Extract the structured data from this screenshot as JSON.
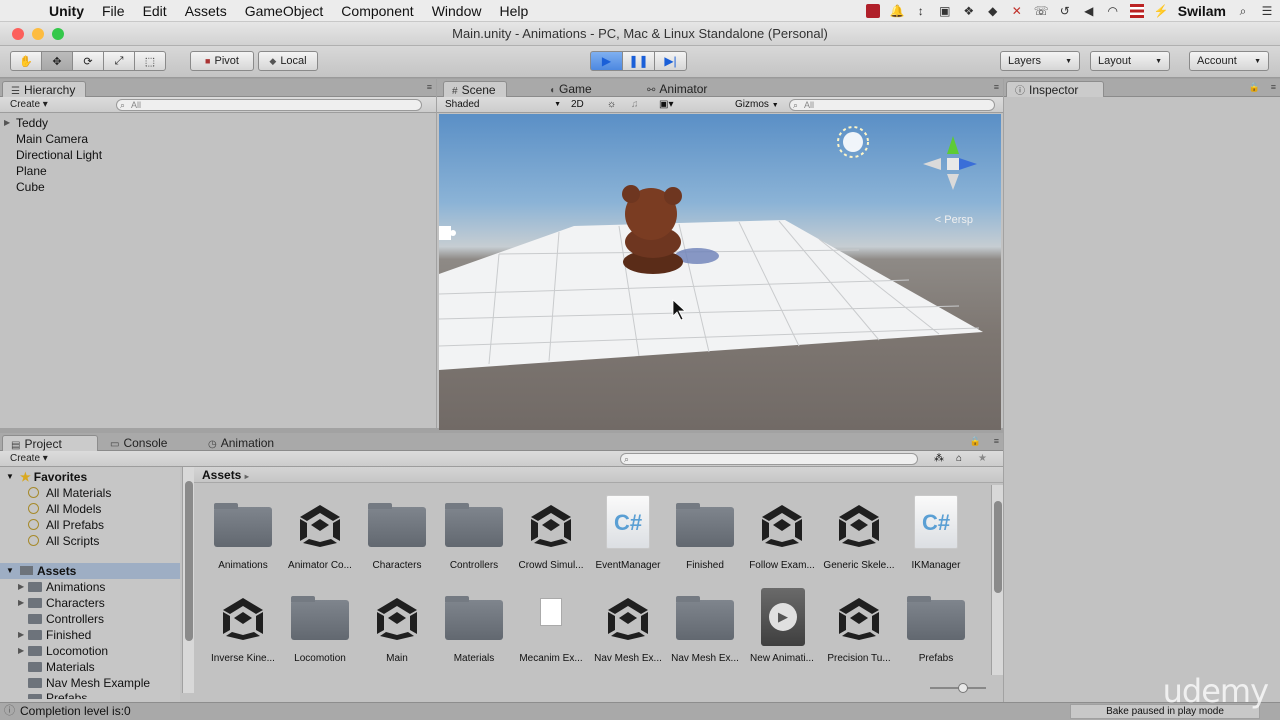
{
  "menubar": {
    "app": "Unity",
    "items": [
      "File",
      "Edit",
      "Assets",
      "GameObject",
      "Component",
      "Window",
      "Help"
    ],
    "user": "Swilam"
  },
  "window": {
    "title": "Main.unity - Animations - PC, Mac & Linux Standalone (Personal)"
  },
  "toolbar": {
    "pivot": "Pivot",
    "local": "Local",
    "layers": "Layers",
    "layout": "Layout",
    "account": "Account"
  },
  "hierarchy": {
    "tab": "Hierarchy",
    "create": "Create",
    "search_placeholder": "All",
    "items": [
      "Teddy",
      "Main Camera",
      "Directional Light",
      "Plane",
      "Cube"
    ]
  },
  "scene": {
    "tabs": [
      "Scene",
      "Game",
      "Animator"
    ],
    "shading": "Shaded",
    "mode_2d": "2D",
    "gizmos": "Gizmos",
    "search_placeholder": "All",
    "persp_label": "Persp"
  },
  "inspector": {
    "tab": "Inspector"
  },
  "project": {
    "tabs": [
      "Project",
      "Console",
      "Animation"
    ],
    "create": "Create",
    "favorites": "Favorites",
    "favorite_items": [
      "All Materials",
      "All Models",
      "All Prefabs",
      "All Scripts"
    ],
    "assets_root": "Assets",
    "asset_folders": [
      "Animations",
      "Characters",
      "Controllers",
      "Finished",
      "Locomotion",
      "Materials",
      "Nav Mesh Example",
      "Prefabs"
    ],
    "breadcrumb": "Assets",
    "grid": [
      {
        "label": "Animations",
        "kind": "folder"
      },
      {
        "label": "Animator Co...",
        "kind": "unity"
      },
      {
        "label": "Characters",
        "kind": "folder"
      },
      {
        "label": "Controllers",
        "kind": "folder"
      },
      {
        "label": "Crowd Simul...",
        "kind": "unity"
      },
      {
        "label": "EventManager",
        "kind": "csharp"
      },
      {
        "label": "Finished",
        "kind": "folder"
      },
      {
        "label": "Follow Exam...",
        "kind": "unity"
      },
      {
        "label": "Generic Skele...",
        "kind": "unity"
      },
      {
        "label": "IKManager",
        "kind": "csharp"
      },
      {
        "label": "Inverse Kine...",
        "kind": "unity"
      },
      {
        "label": "Locomotion",
        "kind": "folder"
      },
      {
        "label": "Main",
        "kind": "unity"
      },
      {
        "label": "Materials",
        "kind": "folder"
      },
      {
        "label": "Mecanim Ex...",
        "kind": "doc"
      },
      {
        "label": "Nav Mesh Ex...",
        "kind": "unity"
      },
      {
        "label": "Nav Mesh Ex...",
        "kind": "folder"
      },
      {
        "label": "New Animati...",
        "kind": "anim"
      },
      {
        "label": "Precision Tu...",
        "kind": "unity"
      },
      {
        "label": "Prefabs",
        "kind": "folder"
      }
    ]
  },
  "status": {
    "message": "Completion level is:0",
    "bake": "Bake paused in play mode"
  },
  "watermark": "udemy",
  "colors": {
    "play_active": "#4d88e0",
    "selection": "#9eaec4"
  }
}
